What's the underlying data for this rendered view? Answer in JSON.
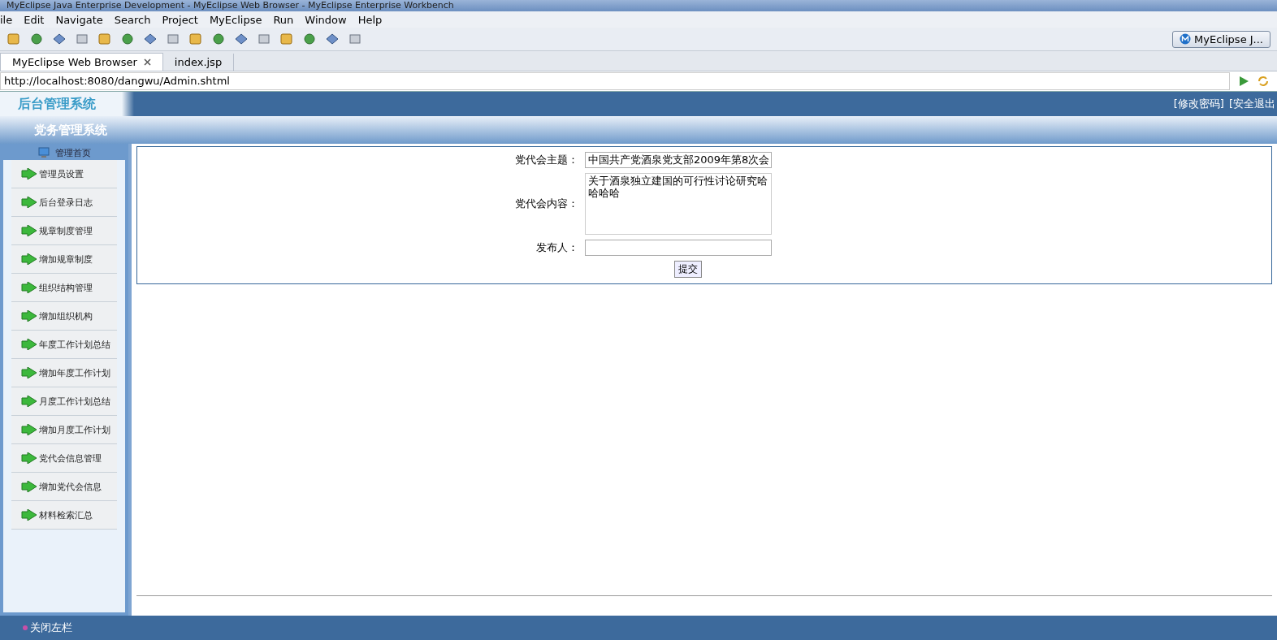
{
  "window": {
    "title": "MyEclipse Java Enterprise Development - MyEclipse Web Browser - MyEclipse Enterprise Workbench"
  },
  "menu": [
    "ile",
    "Edit",
    "Navigate",
    "Search",
    "Project",
    "MyEclipse",
    "Run",
    "Window",
    "Help"
  ],
  "perspective": {
    "label": "MyEclipse J..."
  },
  "editor_tabs": [
    {
      "label": "MyEclipse Web Browser",
      "selected": true,
      "closable": true
    },
    {
      "label": "index.jsp",
      "selected": false,
      "closable": false
    }
  ],
  "address_bar": {
    "value": "http://localhost:8080/dangwu/Admin.shtml"
  },
  "app": {
    "logo": "后台管理系统",
    "header_links": [
      "[修改密码]",
      "[安全退出"
    ],
    "system_name": "党务管理系统",
    "home_link": "管理首页",
    "nav_items": [
      "管理员设置",
      "后台登录日志",
      "规章制度管理",
      "增加规章制度",
      "组织结构管理",
      "增加组织机构",
      "年度工作计划总结",
      "增加年度工作计划",
      "月度工作计划总结",
      "增加月度工作计划",
      "党代会信息管理",
      "增加党代会信息",
      "材料检索汇总"
    ],
    "form": {
      "fields": [
        {
          "kind": "text",
          "label": "党代会主题：",
          "value": "中国共产党酒泉党支部2009年第8次会"
        },
        {
          "kind": "textarea",
          "label": "党代会内容：",
          "value": "关于酒泉独立建国的可行性讨论研究哈哈哈哈"
        },
        {
          "kind": "text",
          "label": "发布人："
        }
      ],
      "submit": "提交"
    },
    "footer_link": "关闭左栏"
  }
}
